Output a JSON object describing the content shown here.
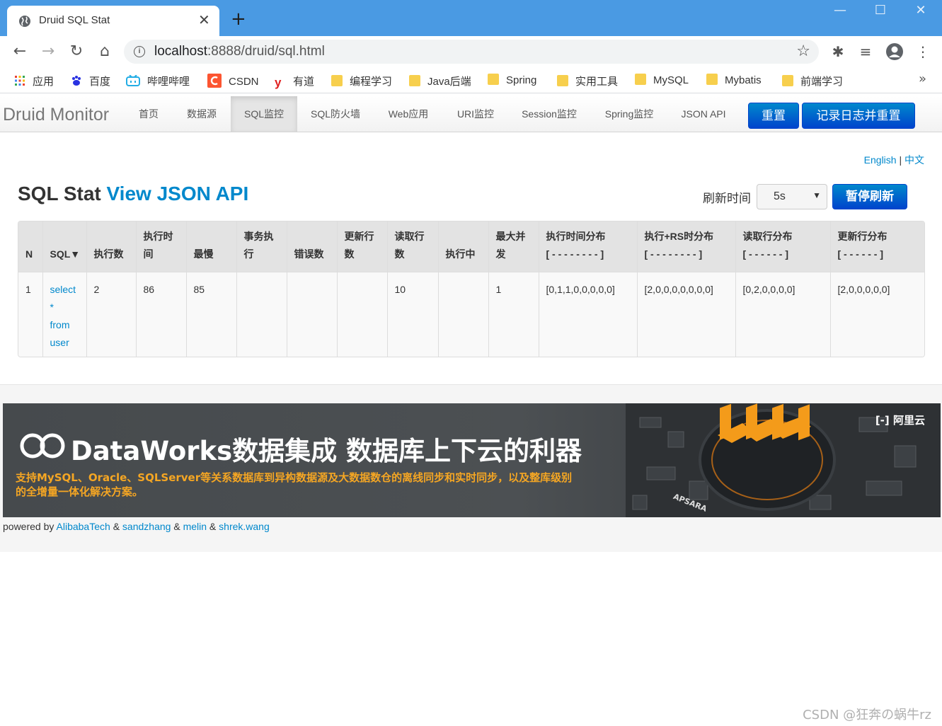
{
  "browser": {
    "tab_title": "Druid SQL Stat",
    "new_tab_glyph": "+",
    "url_host": "localhost",
    "url_path": ":8888/druid/sql.html",
    "bookmarks": [
      {
        "label": "应用",
        "icon": "apps-grid-icon"
      },
      {
        "label": "百度",
        "icon": "baidu-paw-icon"
      },
      {
        "label": "哔哩哔哩",
        "icon": "bilibili-tv-icon"
      },
      {
        "label": "CSDN",
        "icon": "csdn-c-icon"
      },
      {
        "label": "有道",
        "icon": "youdao-y-icon"
      },
      {
        "label": "编程学习",
        "icon": "folder-icon"
      },
      {
        "label": "Java后端",
        "icon": "folder-icon"
      },
      {
        "label": "Spring",
        "icon": "folder-icon"
      },
      {
        "label": "实用工具",
        "icon": "folder-icon"
      },
      {
        "label": "MySQL",
        "icon": "folder-icon"
      },
      {
        "label": "Mybatis",
        "icon": "folder-icon"
      },
      {
        "label": "前端学习",
        "icon": "folder-icon"
      }
    ],
    "more": "»"
  },
  "navbar": {
    "brand": "Druid Monitor",
    "items": [
      "首页",
      "数据源",
      "SQL监控",
      "SQL防火墙",
      "Web应用",
      "URI监控",
      "Session监控",
      "Spring监控",
      "JSON API"
    ],
    "active": "SQL监控",
    "reset_label": "重置",
    "log_reset_label": "记录日志并重置"
  },
  "lang": {
    "english": "English",
    "separator": "|",
    "chinese": "中文"
  },
  "header": {
    "title": "SQL Stat",
    "api_link": "View JSON API",
    "refresh_label": "刷新时间",
    "refresh_value": "5s",
    "pause_label": "暂停刷新"
  },
  "table": {
    "columns": [
      [
        "N"
      ],
      [
        "SQL▼"
      ],
      [
        "执行数"
      ],
      [
        "执行时",
        "间"
      ],
      [
        "最慢"
      ],
      [
        "事务执",
        "行"
      ],
      [
        "错误数"
      ],
      [
        "更新行",
        "数"
      ],
      [
        "读取行",
        "数"
      ],
      [
        "执行中"
      ],
      [
        "最大并",
        "发"
      ],
      [
        "执行时间分布",
        "[ - - - - - - - - ]"
      ],
      [
        "执行+RS时分布",
        "[ - - - - - - - - ]"
      ],
      [
        "读取行分布",
        "[ - - - - - - ]"
      ],
      [
        "更新行分布",
        "[ - - - - - - ]"
      ]
    ],
    "rows": [
      {
        "n": "1",
        "sql": [
          "select",
          "*",
          "from",
          "user"
        ],
        "exec_count": "2",
        "exec_time": "86",
        "slowest": "85",
        "txn": "",
        "errors": "",
        "update_rows": "",
        "read_rows": "10",
        "running": "",
        "max_concurrent": "1",
        "exec_time_dist": "[0,1,1,0,0,0,0,0]",
        "exec_rs_dist": "[2,0,0,0,0,0,0,0]",
        "read_rows_dist": "[0,2,0,0,0,0]",
        "update_rows_dist": "[2,0,0,0,0,0]"
      }
    ]
  },
  "footer": {
    "banner_title": "DataWorks数据集成 数据库上下云的利器",
    "banner_subtitle": "支持MySQL、Oracle、SQLServer等关系数据库到异构数据源及大数据数仓的离线同步和实时同步，以及整库级别的全增量一体化解决方案。",
    "banner_brand": "阿里云",
    "banner_stamp": "APSARA",
    "powered_prefix": "powered by",
    "authors": [
      "AlibabaTech",
      "sandzhang",
      "melin",
      "shrek.wang"
    ],
    "amp": "&"
  },
  "watermark": "CSDN @狂奔の蜗牛rz",
  "colors": {
    "link": "#0088cc",
    "primary": "#0044cc",
    "tabbar": "#4a9ae3",
    "banner_accent": "#f5a623"
  }
}
